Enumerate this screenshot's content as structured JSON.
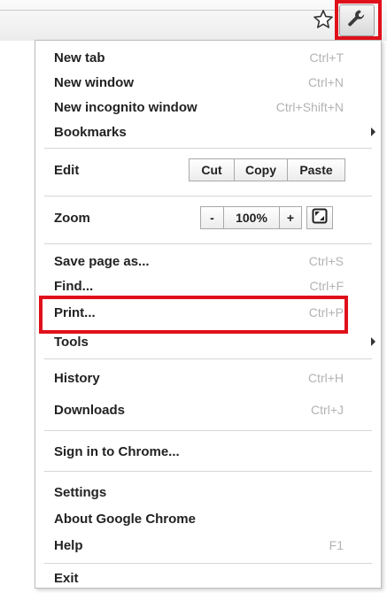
{
  "toolbar": {
    "star_icon": "star-outline-icon",
    "wrench_icon": "wrench-icon",
    "highlight_color": "#e0101b"
  },
  "menu": {
    "new_tab": {
      "label": "New tab",
      "shortcut": "Ctrl+T"
    },
    "new_window": {
      "label": "New window",
      "shortcut": "Ctrl+N"
    },
    "new_incognito": {
      "label": "New incognito window",
      "shortcut": "Ctrl+Shift+N"
    },
    "bookmarks": {
      "label": "Bookmarks"
    },
    "edit": {
      "label": "Edit",
      "cut": "Cut",
      "copy": "Copy",
      "paste": "Paste"
    },
    "zoom": {
      "label": "Zoom",
      "minus": "-",
      "level": "100%",
      "plus": "+",
      "fullscreen_icon": "fullscreen-icon"
    },
    "save_page": {
      "label": "Save page as...",
      "shortcut": "Ctrl+S"
    },
    "find": {
      "label": "Find...",
      "shortcut": "Ctrl+F"
    },
    "print": {
      "label": "Print...",
      "shortcut": "Ctrl+P"
    },
    "tools": {
      "label": "Tools"
    },
    "history": {
      "label": "History",
      "shortcut": "Ctrl+H"
    },
    "downloads": {
      "label": "Downloads",
      "shortcut": "Ctrl+J"
    },
    "sign_in": {
      "label": "Sign in to Chrome..."
    },
    "settings": {
      "label": "Settings"
    },
    "about": {
      "label": "About Google Chrome"
    },
    "help": {
      "label": "Help",
      "shortcut": "F1"
    },
    "exit": {
      "label": "Exit"
    }
  }
}
